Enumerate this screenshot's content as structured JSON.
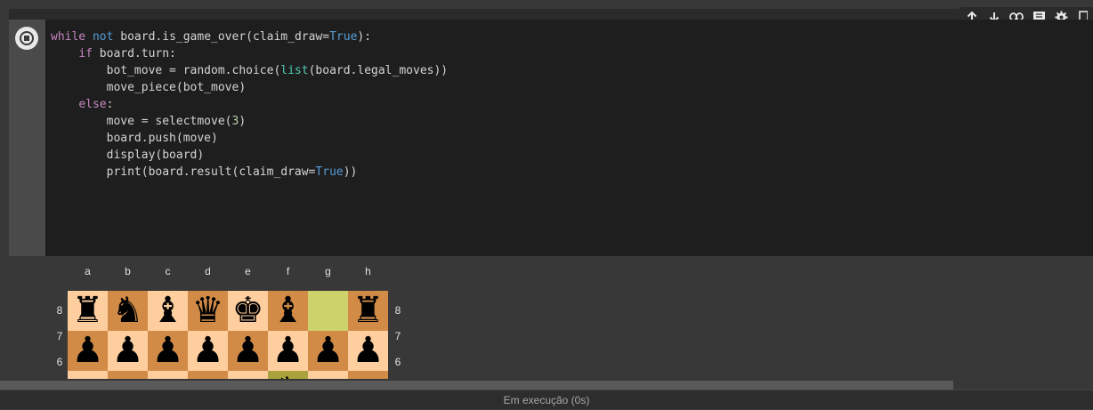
{
  "toolbar": {
    "icons": [
      "arrow-up-icon",
      "arrow-down-icon",
      "link-icon",
      "comment-icon",
      "gear-icon",
      "more-icon"
    ]
  },
  "code": {
    "lines": [
      "while not board.is_game_over(claim_draw=True):",
      "    if board.turn:",
      "        bot_move = random.choice(list(board.legal_moves))",
      "        move_piece(bot_move)",
      "    else:",
      "        move = selectmove(3)",
      "        board.push(move)",
      "        display(board)",
      "        print(board.result(claim_draw=True))"
    ]
  },
  "board": {
    "files": [
      "a",
      "b",
      "c",
      "d",
      "e",
      "f",
      "g",
      "h"
    ],
    "ranks": [
      "8",
      "7",
      "6"
    ],
    "rows": [
      [
        "♜",
        "♞",
        "♝",
        "♛",
        "♚",
        "♝",
        "",
        "♜"
      ],
      [
        "♟",
        "♟",
        "♟",
        "♟",
        "♟",
        "♟",
        "♟",
        "♟"
      ],
      [
        "",
        "",
        "",
        "",
        "",
        "♞",
        "",
        ""
      ]
    ],
    "highlight_squares": [
      "g8",
      "f6"
    ]
  },
  "status": {
    "text": "Em execução (0s)"
  },
  "colors": {
    "light_square": "#ffce9e",
    "dark_square": "#d18b47",
    "highlight_light": "#cdd26a",
    "highlight_dark": "#aaa23a"
  }
}
